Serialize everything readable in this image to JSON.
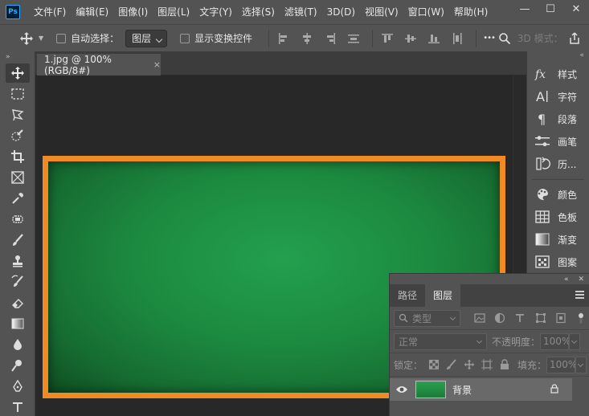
{
  "app": {
    "logo_text": "Ps"
  },
  "menu": [
    "文件(F)",
    "编辑(E)",
    "图像(I)",
    "图层(L)",
    "文字(Y)",
    "选择(S)",
    "滤镜(T)",
    "3D(D)",
    "视图(V)",
    "窗口(W)",
    "帮助(H)"
  ],
  "window_controls": {
    "minimize": "—",
    "maximize": "☐",
    "close": "✕"
  },
  "options": {
    "auto_select_label": "自动选择：",
    "layer_select_value": "图层",
    "show_transform_label": "显示变换控件",
    "more_label": "•••",
    "mode_3d_label": "3D 模式："
  },
  "document": {
    "tab_title": "1.jpg @ 100%(RGB/8#)",
    "close_glyph": "×"
  },
  "right_panel": {
    "collapse_glyph": "«",
    "items": [
      {
        "label": "样式",
        "icon": "fx-icon"
      },
      {
        "label": "字符",
        "icon": "character-icon"
      },
      {
        "label": "段落",
        "icon": "paragraph-icon"
      },
      {
        "label": "画笔",
        "icon": "brush-settings-icon"
      },
      {
        "label": "历...",
        "icon": "history-icon"
      },
      {
        "label": "颜色",
        "icon": "palette-icon"
      },
      {
        "label": "色板",
        "icon": "swatches-icon"
      },
      {
        "label": "渐变",
        "icon": "gradient-icon"
      },
      {
        "label": "图案",
        "icon": "pattern-icon"
      }
    ]
  },
  "toolbar": {
    "collapse_glyph": "»"
  },
  "layers_panel": {
    "collapse_glyph": "«",
    "close_glyph": "✕",
    "tabs": [
      "路径",
      "图层"
    ],
    "active_tab": "图层",
    "filter_kind": "类型",
    "blend_mode": "正常",
    "opacity_label": "不透明度：",
    "opacity_value": "100%",
    "lock_label": "锁定：",
    "fill_label": "填充：",
    "fill_value": "100%",
    "layer": {
      "name": "背景",
      "visible": true,
      "locked": true,
      "thumb_color": "#1f8a40"
    }
  },
  "colors": {
    "chalkboard_frame": "#f08a24",
    "chalkboard_green": "#1c8a40",
    "ui_panel": "#535353",
    "canvas_bg": "#282828"
  }
}
